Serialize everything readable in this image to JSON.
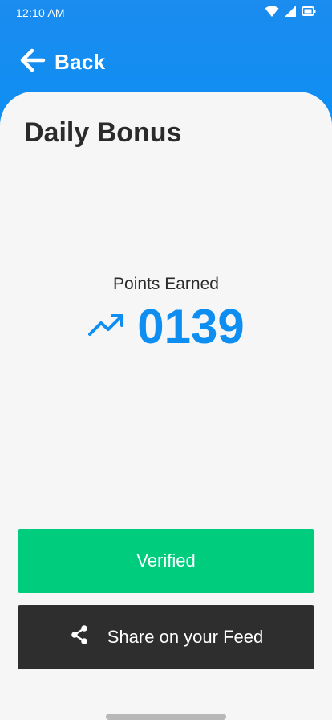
{
  "status_bar": {
    "time": "12:10 AM"
  },
  "header": {
    "back_label": "Back"
  },
  "page": {
    "title": "Daily Bonus",
    "points_label": "Points Earned",
    "points_value": "0139"
  },
  "actions": {
    "verified_label": "Verified",
    "share_label": "Share on your Feed"
  },
  "icons": {
    "back": "arrow-left-icon",
    "trend": "trending-up-icon",
    "share": "share-icon",
    "wifi": "wifi-icon",
    "signal": "signal-icon",
    "battery": "battery-icon"
  },
  "colors": {
    "header_blue": "#0f8ef2",
    "verified_green": "#00cc7e",
    "share_dark": "#2e2e2e",
    "title_text": "#2b2b2b",
    "background": "#f6f6f6"
  }
}
